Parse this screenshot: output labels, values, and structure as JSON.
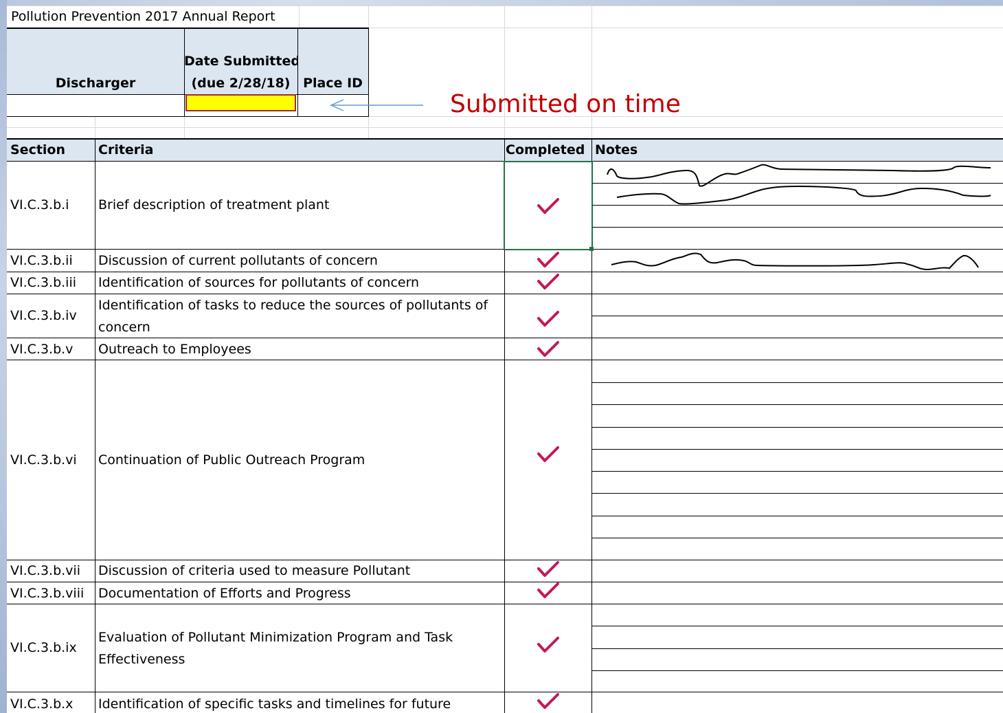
{
  "title": "Pollution Prevention 2017 Annual Report",
  "header": {
    "discharger": "Discharger",
    "date_submitted_line1": "Date Submitted",
    "date_submitted_line2": "(due 2/28/18)",
    "place_id": "Place ID"
  },
  "annotation": {
    "text": "Submitted on time",
    "color": "#c00000",
    "arrow_color": "#5b9bd5",
    "highlight_color": "#ffff00"
  },
  "table_headers": {
    "section": "Section",
    "criteria": "Criteria",
    "completed": "Completed",
    "notes": "Notes"
  },
  "rows": [
    {
      "section": "VI.C.3.b.i",
      "criteria": "Brief description of treatment plant",
      "completed": true
    },
    {
      "section": "VI.C.3.b.ii",
      "criteria": "Discussion of current pollutants of concern",
      "completed": true
    },
    {
      "section": "VI.C.3.b.iii",
      "criteria": "Identification of sources for pollutants of concern",
      "completed": true
    },
    {
      "section": "VI.C.3.b.iv",
      "criteria": "Identification of tasks to reduce the sources of pollutants of concern",
      "completed": true
    },
    {
      "section": "VI.C.3.b.v",
      "criteria": "Outreach to Employees",
      "completed": true
    },
    {
      "section": "VI.C.3.b.vi",
      "criteria": "Continuation of Public Outreach Program",
      "completed": true
    },
    {
      "section": "VI.C.3.b.vii",
      "criteria": "Discussion of criteria used to measure Pollutant",
      "completed": true
    },
    {
      "section": "VI.C.3.b.viii",
      "criteria": "Documentation of Efforts and Progress",
      "completed": true
    },
    {
      "section": "VI.C.3.b.ix",
      "criteria": "Evaluation of Pollutant Minimization Program and Task Effectiveness",
      "completed": true
    },
    {
      "section": "VI.C.3.b.x",
      "criteria": "Identification of specific tasks and timelines for future",
      "completed": true
    }
  ],
  "colors": {
    "header_fill": "#dce6f1",
    "check": "#c2185b",
    "selection": "#217346"
  },
  "icons": [
    "checkmark-icon",
    "arrow-left-icon",
    "handwriting-scribble"
  ]
}
